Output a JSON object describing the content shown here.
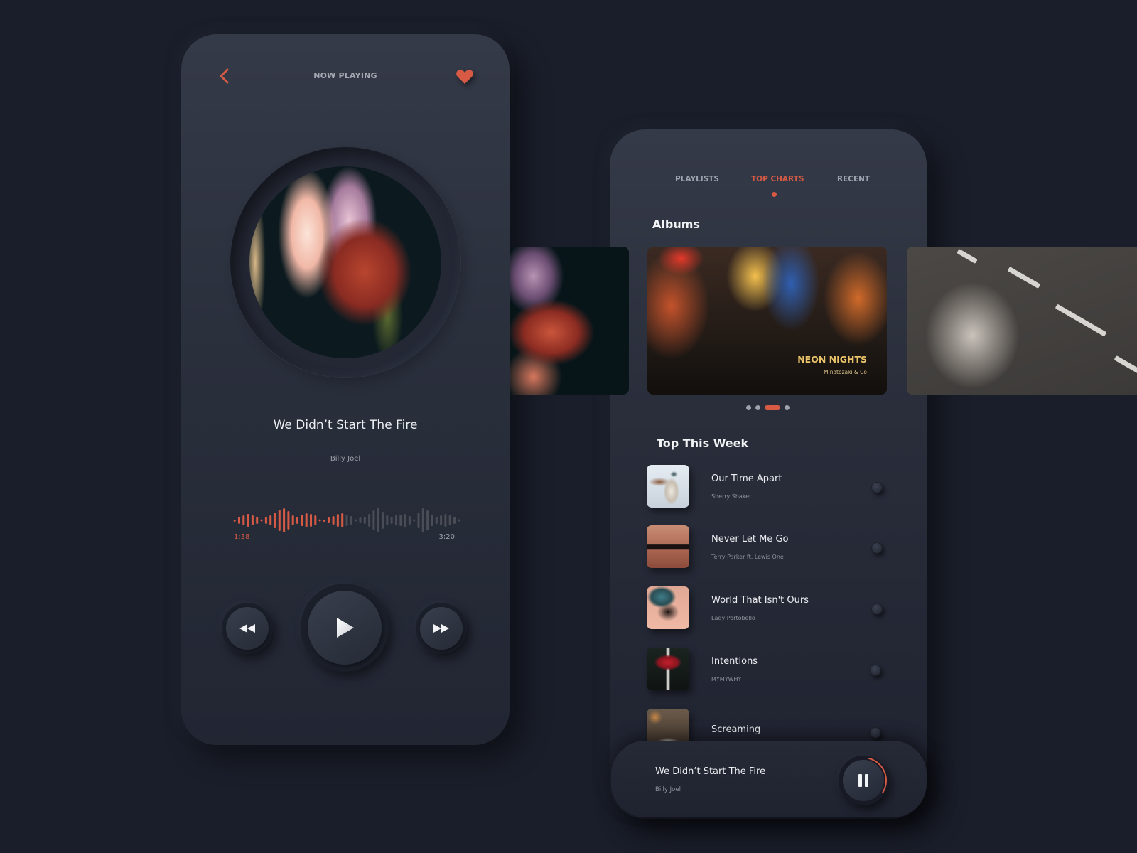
{
  "now_playing": {
    "header_title": "NOW PLAYING",
    "back_icon": "chevron-left-icon",
    "favorite_icon": "heart-icon",
    "song_title": "We Didn’t Start The Fire",
    "artist": "Billy Joel",
    "time_elapsed": "1:38",
    "time_total": "3:20",
    "progress_fraction": 0.49,
    "controls": {
      "rewind_icon": "rewind-icon",
      "play_icon": "play-icon",
      "forward_icon": "fast-forward-icon"
    }
  },
  "library": {
    "tabs": [
      {
        "label": "PLAYLISTS",
        "active": false
      },
      {
        "label": "TOP CHARTS",
        "active": true
      },
      {
        "label": "RECENT",
        "active": false
      }
    ],
    "albums_heading": "Albums",
    "albums": [
      {
        "title": "",
        "artist": ""
      },
      {
        "title": "NEON NIGHTS",
        "artist": "Minatozaki & Co"
      },
      {
        "title": "",
        "artist": ""
      }
    ],
    "carousel_pages": 4,
    "carousel_active_index": 2,
    "top_heading": "Top This Week",
    "tracks": [
      {
        "title": "Our Time Apart",
        "artist": "Sherry Shaker"
      },
      {
        "title": "Never Let Me Go",
        "artist": "Terry Parker ft. Lewis One"
      },
      {
        "title": "World That Isn't Ours",
        "artist": "Lady Portobello"
      },
      {
        "title": "Intentions",
        "artist": "MYMYWHY"
      },
      {
        "title": "Screaming",
        "artist": ""
      }
    ]
  },
  "mini_player": {
    "title": "We Didn’t Start The Fire",
    "artist": "Billy Joel",
    "pause_icon": "pause-icon",
    "progress_fraction": 0.3
  },
  "colors": {
    "accent": "#d75a45",
    "background": "#1a1e2a",
    "album_title": "#eac36a",
    "wave_inactive": "#4a4d55"
  }
}
